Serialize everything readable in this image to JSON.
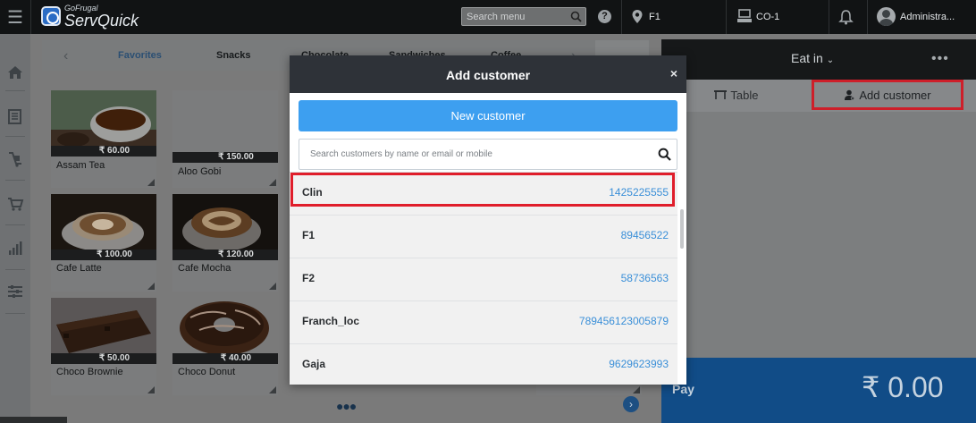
{
  "topbar": {
    "logo_small": "GoFrugal",
    "logo_main": "ServQuick",
    "search_placeholder": "Search menu",
    "location": "F1",
    "counter": "CO-1",
    "user": "Administra..."
  },
  "categories": [
    "Favorites",
    "Snacks",
    "Chocolate",
    "Sandwiches",
    "Coffee"
  ],
  "items": [
    {
      "name": "Assam Tea",
      "price": "₹ 60.00"
    },
    {
      "name": "Aloo Gobi",
      "price": "₹ 150.00"
    },
    {
      "name": "Cafe Latte",
      "price": "₹ 100.00"
    },
    {
      "name": "Cafe Mocha",
      "price": "₹ 120.00"
    },
    {
      "name": "Choco Brownie",
      "price": "₹ 50.00"
    },
    {
      "name": "Choco Donut",
      "price": "₹ 40.00"
    }
  ],
  "order_panel": {
    "order_type": "Eat in",
    "table_tab": "Table",
    "add_customer_tab": "Add customer",
    "pay_label": "Pay",
    "pay_amount": "₹ 0.00"
  },
  "modal": {
    "title": "Add customer",
    "close": "×",
    "new_customer": "New customer",
    "search_placeholder": "Search customers by name or email or mobile",
    "customers": [
      {
        "name": "Clin",
        "phone": "1425225555"
      },
      {
        "name": "F1",
        "phone": "89456522"
      },
      {
        "name": "F2",
        "phone": "58736563"
      },
      {
        "name": "Franch_loc",
        "phone": "789456123005879"
      },
      {
        "name": "Gaja",
        "phone": "9629623993"
      }
    ]
  },
  "colors": {
    "accent_blue": "#3d9ff0",
    "highlight_red": "#e01e2b",
    "phone_link": "#3a8fd8",
    "pay_blue": "#114c87"
  }
}
